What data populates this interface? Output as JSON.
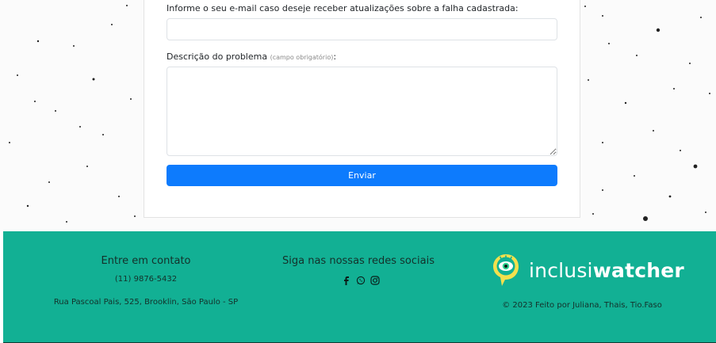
{
  "form": {
    "email_label": "Informe o seu e-mail caso deseje receber atualizações sobre a falha cadastrada:",
    "email_value": "",
    "description_label": "Descrição do problema",
    "description_hint": "(campo obrigatório)",
    "description_colon": ":",
    "description_value": "",
    "submit_label": "Enviar"
  },
  "footer": {
    "contact_title": "Entre em contato",
    "phone": "(11) 9876-5432",
    "address": "Rua Pascoal Pais, 525, Brooklin, São Paulo - SP",
    "social_title": "Siga nas nossas redes sociais",
    "social_icons": [
      "facebook-icon",
      "whatsapp-icon",
      "instagram-icon"
    ],
    "brand_name_light": "inclusi",
    "brand_name_bold": "watcher",
    "copyright": "© 2023 Feito por Juliana, Thais, Tio.Faso"
  },
  "colors": {
    "footer_bg": "#12b094",
    "button_bg": "#0d7bfd",
    "logo_yellow": "#f4e04d",
    "logo_green": "#2fd18f"
  }
}
